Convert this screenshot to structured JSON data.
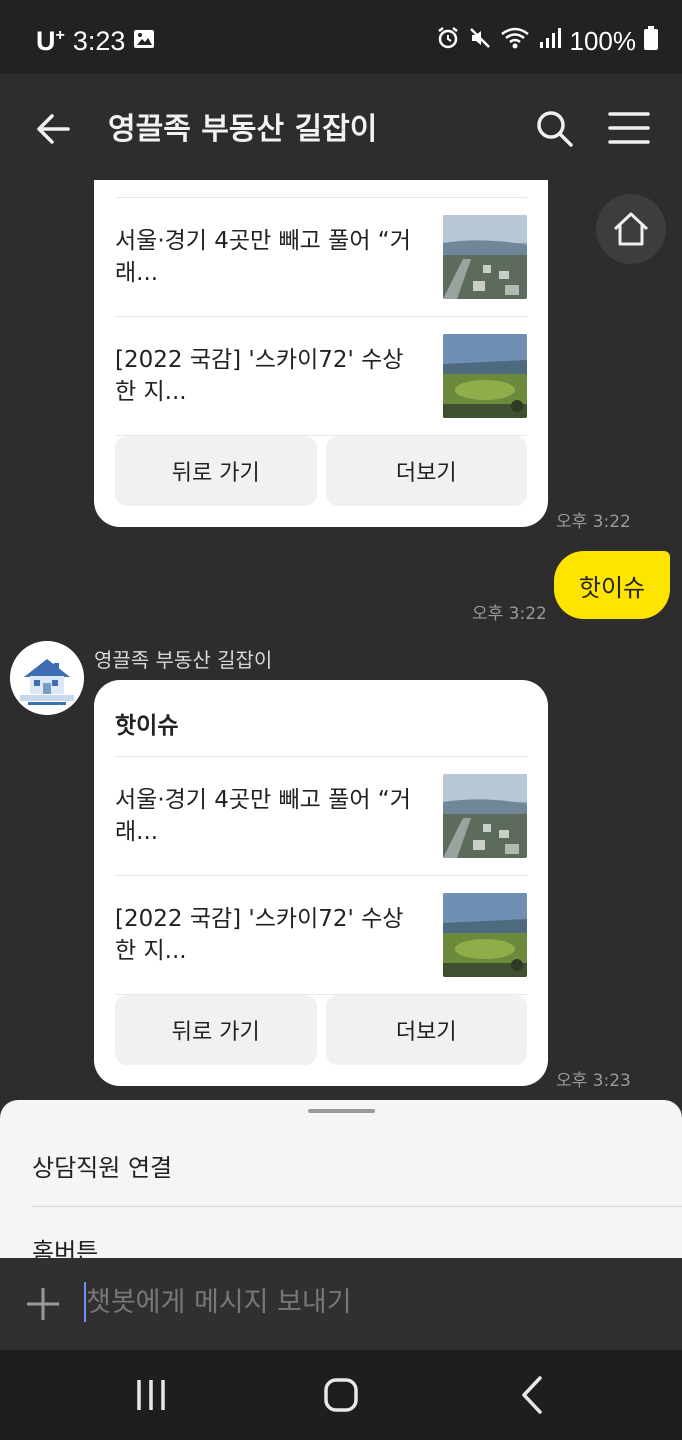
{
  "status_bar": {
    "carrier": "U",
    "carrier_sup": "+",
    "time": "3:23",
    "battery": "100%"
  },
  "header": {
    "title": "영끌족 부동산 길잡이"
  },
  "icons": {
    "back": "arrow-left-icon",
    "search": "search-icon",
    "menu": "hamburger-menu-icon",
    "home": "home-icon",
    "plus": "plus-icon"
  },
  "colors": {
    "bubble_yellow": "#fee500",
    "background": "#2d2d2d",
    "card": "#ffffff"
  },
  "chat": {
    "card1": {
      "items": [
        {
          "text": "서울·경기 4곳만 빼고 풀어 “거래..."
        },
        {
          "text": "[2022 국감] '스카이72' 수상한 지..."
        }
      ],
      "buttons": {
        "back": "뒤로 가기",
        "more": "더보기"
      },
      "time": "오후 3:22"
    },
    "my_message": {
      "text": "핫이슈",
      "time": "오후 3:22"
    },
    "bot_name": "영끌족 부동산 길잡이",
    "card2": {
      "title": "핫이슈",
      "items": [
        {
          "text": "서울·경기 4곳만 빼고 풀어 “거래..."
        },
        {
          "text": "[2022 국감] '스카이72' 수상한 지..."
        }
      ],
      "buttons": {
        "back": "뒤로 가기",
        "more": "더보기"
      },
      "time": "오후 3:23"
    }
  },
  "sheet": {
    "items": [
      "상담직원 연결",
      "홈버튼"
    ]
  },
  "input": {
    "placeholder": "챗봇에게 메시지 보내기",
    "value": ""
  }
}
